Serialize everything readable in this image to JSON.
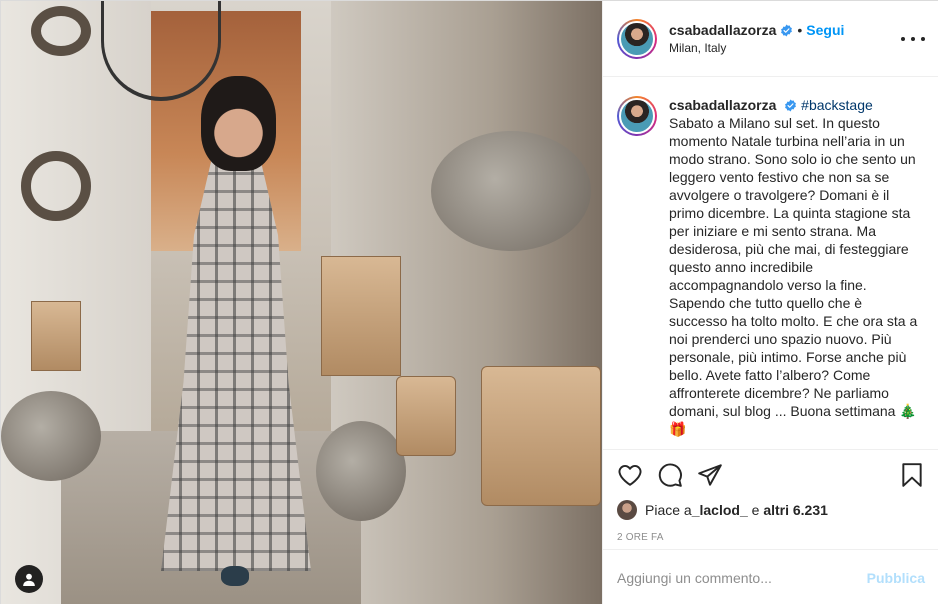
{
  "post": {
    "username": "csabadallazorza",
    "follow_label": "Segui",
    "separator": "•",
    "location": "Milan, Italy",
    "caption_username": "csabadallazorza",
    "hashtag": "#backstage",
    "caption_text": "Sabato a Milano sul set. In questo momento Natale turbina nell’aria in un modo strano. Sono solo io che sento un leggero vento festivo che non sa se avvolgere o travolgere? Domani è il primo dicembre. La quinta stagione sta per iniziare e mi sento strana. Ma desiderosa, più che mai, di festeggiare questo anno incredibile accompagnandolo verso la fine. Sapendo che tutto quello che è successo ha tolto molto. E che ora sta a noi prenderci uno spazio nuovo. Più personale, più intimo. Forse anche più bello. Avete fatto l’albero? Come affronterete dicembre? Ne parliamo domani, sul blog ... Buona settimana 🎄 🎁",
    "likes_prefix": "Piace a ",
    "likes_user": "_laclod_",
    "likes_mid": " e ",
    "likes_count": "altri 6.231",
    "timestamp": "2 ORE FA"
  },
  "comment_box": {
    "placeholder": "Aggiungi un commento...",
    "publish_label": "Pubblica"
  },
  "icons": {
    "verified": "verified-badge-icon",
    "more": "more-options-icon",
    "like": "heart-icon",
    "comment": "comment-icon",
    "share": "share-icon",
    "save": "bookmark-icon",
    "user_tag": "user-tag-icon"
  },
  "colors": {
    "accent": "#0095f6",
    "publish_disabled": "#b2dffc",
    "hashtag": "#00376b",
    "muted": "#8e8e8e"
  }
}
